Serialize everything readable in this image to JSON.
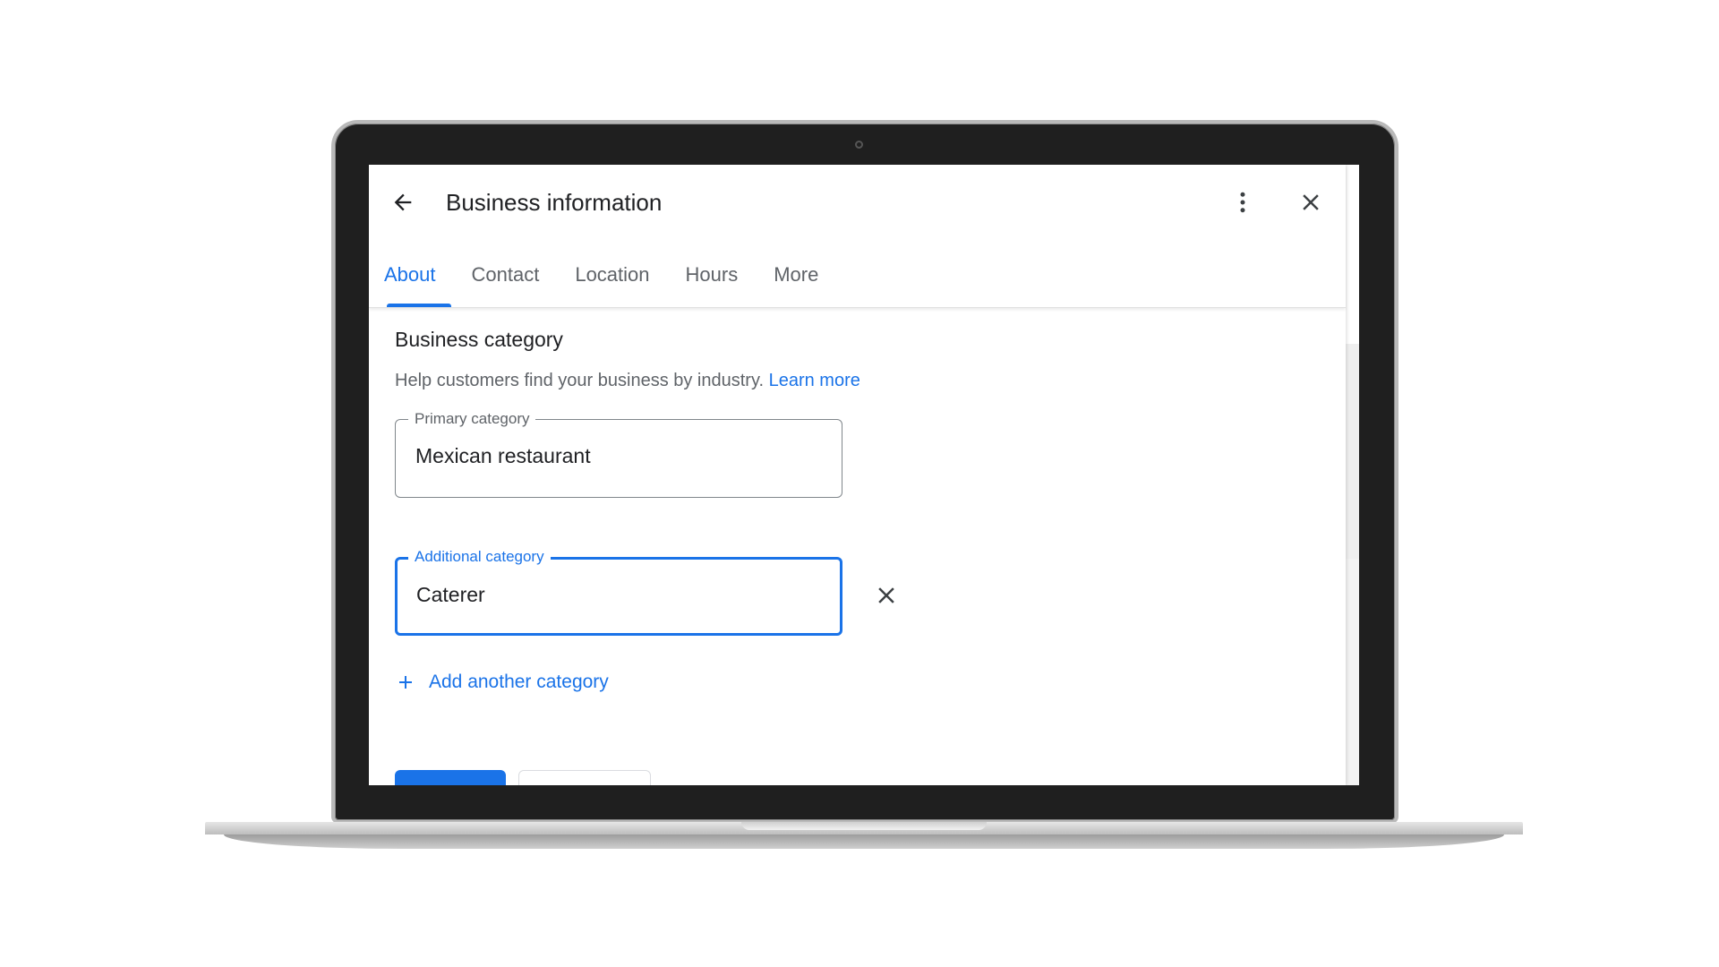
{
  "dialog": {
    "title": "Business information",
    "icons": {
      "back": "arrow-back-icon",
      "more": "more-vert-icon",
      "close": "close-icon"
    }
  },
  "tabs": [
    {
      "label": "About",
      "active": true
    },
    {
      "label": "Contact",
      "active": false
    },
    {
      "label": "Location",
      "active": false
    },
    {
      "label": "Hours",
      "active": false
    },
    {
      "label": "More",
      "active": false
    }
  ],
  "category_section": {
    "title": "Business category",
    "help_text": "Help customers find your business by industry.",
    "learn_more": "Learn more",
    "primary": {
      "label": "Primary category",
      "value": "Mexican restaurant"
    },
    "additional": {
      "label": "Additional category",
      "value": "Caterer"
    },
    "add_another": "Add another category"
  },
  "colors": {
    "accent": "#1a73e8",
    "text_primary": "#202124",
    "text_secondary": "#5f6368",
    "laptop_bezel": "#1f1f1f"
  }
}
